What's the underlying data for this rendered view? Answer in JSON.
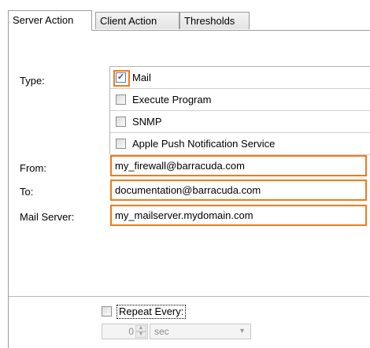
{
  "tabs": [
    {
      "label": "Server Action",
      "active": true
    },
    {
      "label": "Client Action",
      "active": false
    },
    {
      "label": "Thresholds",
      "active": false
    }
  ],
  "type_section": {
    "label": "Type:",
    "options": [
      {
        "label": "Mail",
        "checked": true
      },
      {
        "label": "Execute Program",
        "checked": false
      },
      {
        "label": "SNMP",
        "checked": false
      },
      {
        "label": "Apple Push Notification Service",
        "checked": false
      }
    ]
  },
  "fields": {
    "from": {
      "label": "From:",
      "value": "my_firewall@barracuda.com"
    },
    "to": {
      "label": "To:",
      "value": "documentation@barracuda.com"
    },
    "mail_server": {
      "label": "Mail Server:",
      "value": "my_mailserver.mydomain.com"
    }
  },
  "repeat": {
    "label": "Repeat Every:",
    "checked": false,
    "value": "0",
    "unit": "sec"
  },
  "colors": {
    "highlight": "#f07a1c",
    "border": "#9c9c9c"
  }
}
